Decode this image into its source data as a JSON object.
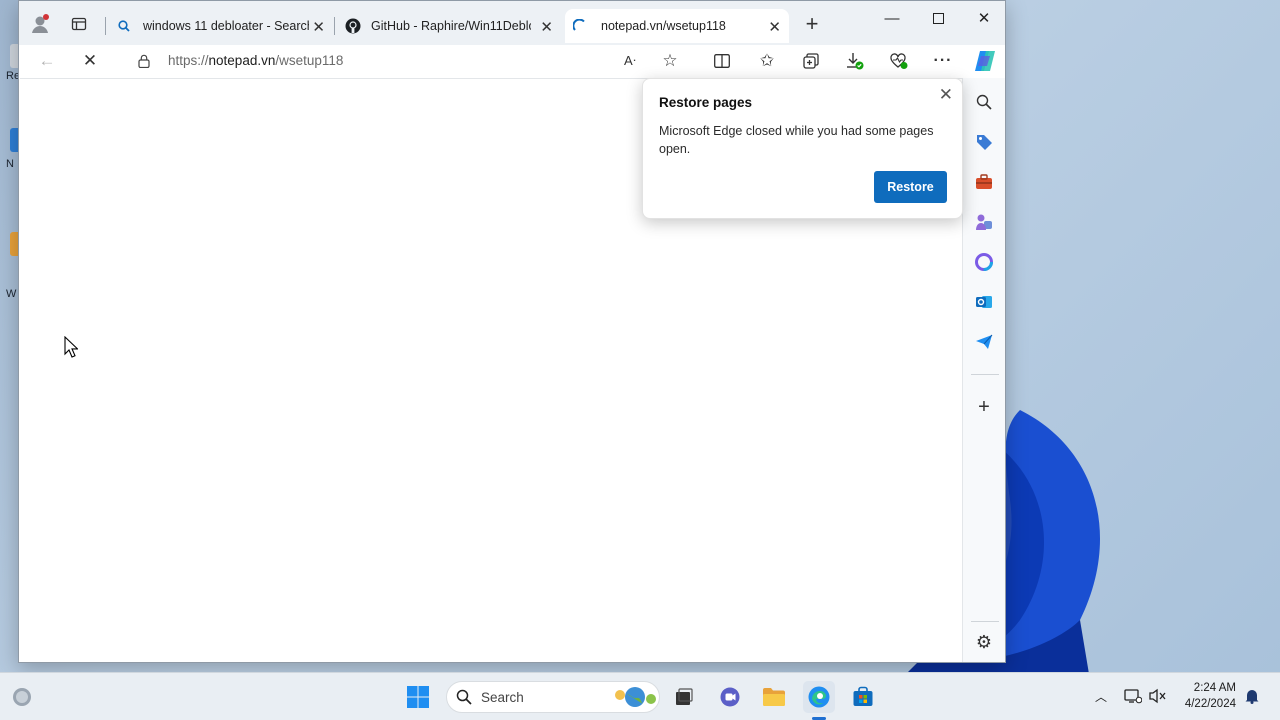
{
  "desktop": {
    "icon_labels": [
      "Re",
      "N",
      "W"
    ]
  },
  "browser": {
    "tabs": [
      {
        "title": "windows 11 debloater - Search",
        "icon": "search-icon"
      },
      {
        "title": "GitHub - Raphire/Win11Debloa",
        "icon": "github-icon"
      },
      {
        "title": "notepad.vn/wsetup118",
        "icon": "loading-icon"
      }
    ],
    "address": {
      "scheme": "https://",
      "host": "notepad.vn",
      "path": "/wsetup118"
    },
    "accent": "#0f6cbd"
  },
  "popup": {
    "title": "Restore pages",
    "message": "Microsoft Edge closed while you had some pages open.",
    "button": "Restore"
  },
  "taskbar": {
    "search_label": "Search",
    "time": "2:24 AM",
    "date": "4/22/2024"
  }
}
